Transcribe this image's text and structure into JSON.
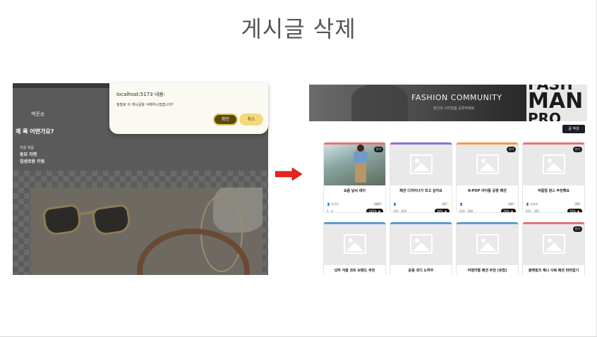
{
  "slide": {
    "title": "게시글 삭제"
  },
  "left_screenshot": {
    "author": "백준승",
    "question": "제 룩 어떤가요?",
    "item_header": "착용 제품",
    "item_1": "동묘 자켓",
    "item_2": "집샌로랑 키링",
    "dialog": {
      "title": "localhost:5173 내용:",
      "message": "정말로 이 게시글을 삭제하시겠습니까?",
      "ok_label": "확인",
      "cancel_label": "취소"
    }
  },
  "arrow_color": "#e8231d",
  "right_screenshot": {
    "banner": {
      "title": "FASHION COMMUNITY",
      "subtitle": "당신의 스타일을 공유하세요",
      "big_text_1": "FASH",
      "big_text_2": "MAN",
      "big_text_3": "PRO"
    },
    "write_button": "글 작성",
    "cards": [
      {
        "title": "요즘 날씨 데이",
        "badge": "인기",
        "author": "박구도",
        "temp": "100°",
        "stats": "1 · 0",
        "pct": "100% 🔥",
        "accent": "#e57373",
        "has_photo": true
      },
      {
        "title": "패션 디자이너가 되고 싶어요",
        "badge": "",
        "author": "",
        "temp": "31°",
        "stats": "130 · 620",
        "pct": "39% 🔥",
        "accent": "#8e6fd6",
        "has_photo": false
      },
      {
        "title": "K-POP 아이돌 공항 패션",
        "badge": "인기",
        "author": "",
        "temp": "54°",
        "stats": "520 · 180",
        "pct": "78% 🔥",
        "accent": "#f2994a",
        "has_photo": false
      },
      {
        "title": "여름철 원스 추천해요",
        "badge": "인기",
        "author": "연성호",
        "temp": "76°",
        "stats": "455 · 345",
        "pct": "76% 🔥",
        "accent": "#e57373",
        "has_photo": false
      },
      {
        "title": "남자 겨울 코트 브랜드 추천",
        "badge": "",
        "author": "",
        "temp": "",
        "stats": "",
        "pct": "",
        "accent": "#5b9bd5",
        "has_photo": false
      },
      {
        "title": "운동 코디 노하우",
        "badge": "",
        "author": "",
        "temp": "",
        "stats": "",
        "pct": "",
        "accent": "#5b9bd5",
        "has_photo": false
      },
      {
        "title": "여행지별 패션 추천 (유럽)",
        "badge": "",
        "author": "",
        "temp": "",
        "stats": "",
        "pct": "",
        "accent": "#5b9bd5",
        "has_photo": false
      },
      {
        "title": "블랙핑크 제니 사복 패션 따라잡기",
        "badge": "인기",
        "author": "",
        "temp": "",
        "stats": "",
        "pct": "",
        "accent": "#e57373",
        "has_photo": false
      }
    ]
  }
}
